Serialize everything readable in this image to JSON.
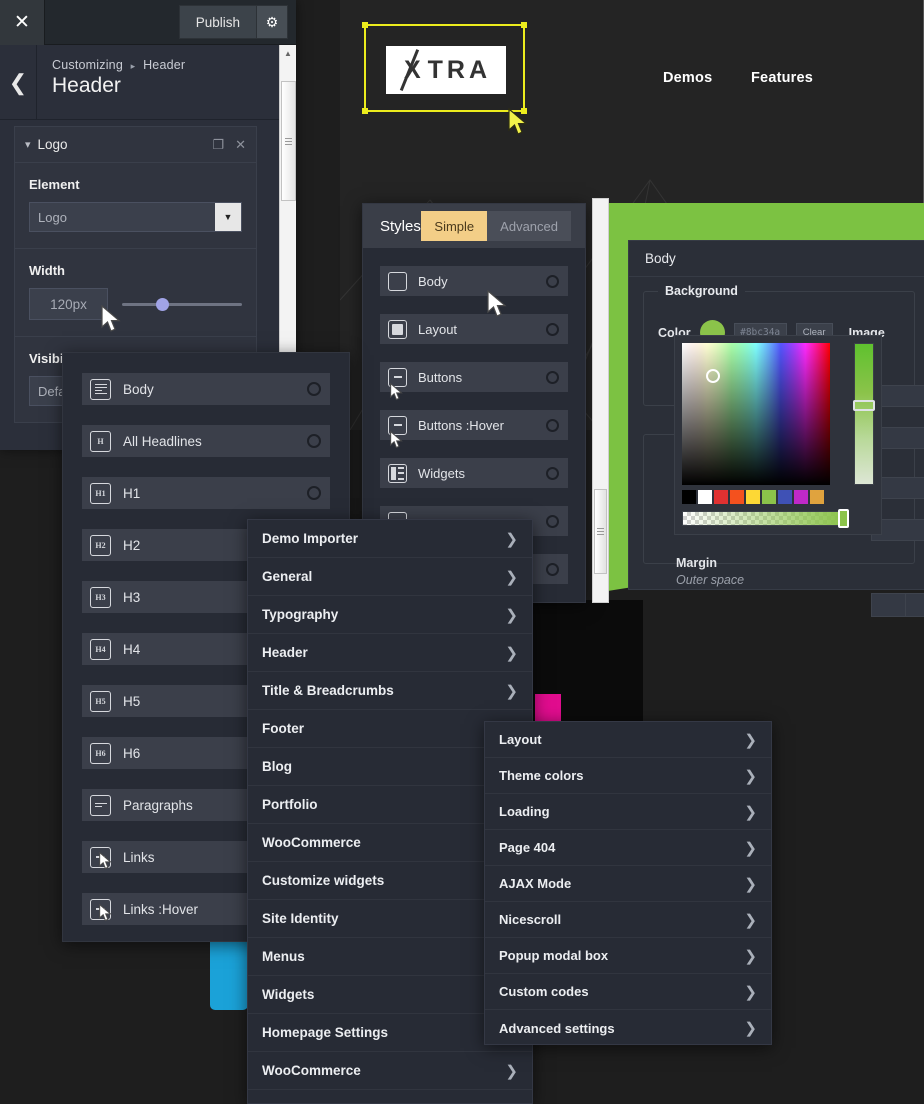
{
  "customizer": {
    "close_icon": "close-icon",
    "publish_label": "Publish",
    "gear_icon": "gear-icon",
    "back_icon": "chevron-left-icon",
    "breadcrumb_root": "Customizing",
    "breadcrumb_sep": "▸",
    "breadcrumb_current": "Header",
    "page_title": "Header",
    "section": {
      "title": "Logo",
      "collapse_icon": "chevron-down-icon",
      "duplicate_icon": "copy-icon",
      "remove_icon": "close-icon",
      "element_label": "Element",
      "element_value": "Logo",
      "element_dropdown_icon": "chevron-down-icon",
      "width_label": "Width",
      "width_value": "120px",
      "visibility_label": "Visibility",
      "visibility_value": "Default"
    }
  },
  "site_preview": {
    "logo_text": "TRA",
    "logo_letter": "X",
    "nav": [
      {
        "label": "Demos"
      },
      {
        "label": "Features"
      }
    ],
    "selection_color": "#ecec1d"
  },
  "typography_panel": {
    "items": [
      {
        "label": "Body",
        "icon": "document-lines-icon"
      },
      {
        "label": "All Headlines",
        "icon": "heading-icon"
      },
      {
        "label": "H1",
        "icon": "h1-icon"
      },
      {
        "label": "H2",
        "icon": "h2-icon"
      },
      {
        "label": "H3",
        "icon": "h3-icon"
      },
      {
        "label": "H4",
        "icon": "h4-icon"
      },
      {
        "label": "H5",
        "icon": "h5-icon"
      },
      {
        "label": "H6",
        "icon": "h6-icon"
      },
      {
        "label": "Paragraphs",
        "icon": "paragraph-icon"
      },
      {
        "label": "Links",
        "icon": "link-box-icon"
      },
      {
        "label": "Links :Hover",
        "icon": "link-box-icon"
      }
    ]
  },
  "styles_panel": {
    "title": "Styles",
    "tabs": [
      {
        "label": "Simple",
        "active": true
      },
      {
        "label": "Advanced",
        "active": false
      }
    ],
    "accent_color": "#f3ce87",
    "items": [
      {
        "label": "Body",
        "icon": "square-outline-icon"
      },
      {
        "label": "Layout",
        "icon": "square-filled-icon"
      },
      {
        "label": "Buttons",
        "icon": "button-icon"
      },
      {
        "label": "Buttons :Hover",
        "icon": "button-icon"
      },
      {
        "label": "Widgets",
        "icon": "widgets-icon"
      }
    ]
  },
  "body_editor": {
    "title": "Body",
    "background_legend": "Background",
    "color_label": "Color",
    "color_value": "#8bc34a",
    "color_hex_text": "#8bc34a",
    "clear_label": "Clear",
    "image_label": "Image",
    "margin_label": "Margin",
    "margin_hint": "Outer space",
    "preset_swatches": [
      "#000000",
      "#ffffff",
      "#e03131",
      "#f4511e",
      "#fdd835",
      "#8bc34a",
      "#3f51b5",
      "#c029c8",
      "#e0a33e"
    ]
  },
  "customizer_menu": {
    "items": [
      {
        "label": "Demo Importer",
        "has_arrow": true
      },
      {
        "label": "General",
        "has_arrow": true
      },
      {
        "label": "Typography",
        "has_arrow": true
      },
      {
        "label": "Header",
        "has_arrow": true
      },
      {
        "label": "Title & Breadcrumbs",
        "has_arrow": true
      },
      {
        "label": "Footer",
        "has_arrow": false
      },
      {
        "label": "Blog",
        "has_arrow": false
      },
      {
        "label": "Portfolio",
        "has_arrow": false
      },
      {
        "label": "WooCommerce",
        "has_arrow": false
      },
      {
        "label": "Customize widgets",
        "has_arrow": false
      },
      {
        "label": "Site Identity",
        "has_arrow": false
      },
      {
        "label": "Menus",
        "has_arrow": false
      },
      {
        "label": "Widgets",
        "has_arrow": false
      },
      {
        "label": "Homepage Settings",
        "has_arrow": false
      },
      {
        "label": "WooCommerce",
        "has_arrow": true
      }
    ],
    "arrow_icon": "chevron-right-icon"
  },
  "sub_menu": {
    "items": [
      {
        "label": "Layout"
      },
      {
        "label": "Theme colors"
      },
      {
        "label": "Loading"
      },
      {
        "label": "Page 404"
      },
      {
        "label": "AJAX Mode"
      },
      {
        "label": "Nicescroll"
      },
      {
        "label": "Popup modal box"
      },
      {
        "label": "Custom codes"
      },
      {
        "label": "Advanced settings"
      }
    ],
    "arrow_icon": "chevron-right-icon"
  },
  "decor": {
    "magenta": "#e20d8f",
    "blue": "#1ba2d8",
    "green": "#7cc242"
  }
}
